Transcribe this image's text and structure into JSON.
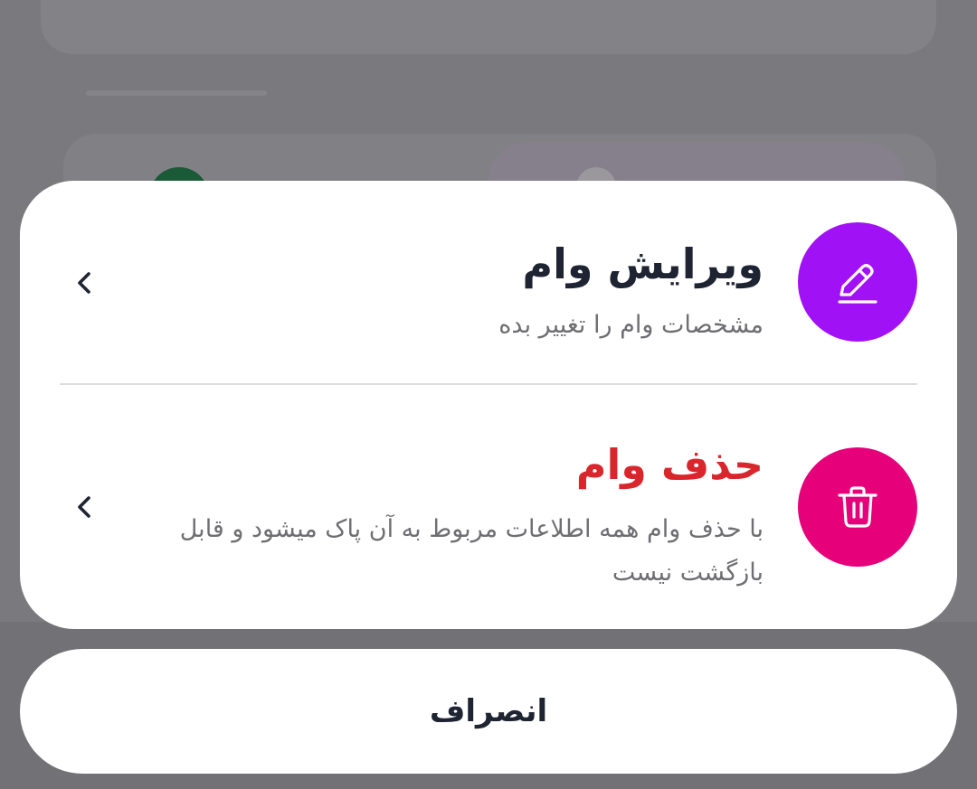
{
  "sheet": {
    "edit": {
      "title": "ویرایش وام",
      "description": "مشخصات وام را تغییر بده",
      "icon": "pencil-icon",
      "icon_bg": "#a111f5",
      "title_color": "#1f2433"
    },
    "delete": {
      "title": "حذف وام",
      "description": "با حذف وام همه اطلاعات مربوط به آن پاک میشود و قابل بازگشت نیست",
      "icon": "trash-icon",
      "icon_bg": "#e6007a",
      "title_color": "#d9262c"
    }
  },
  "cancel_label": "انصراف"
}
